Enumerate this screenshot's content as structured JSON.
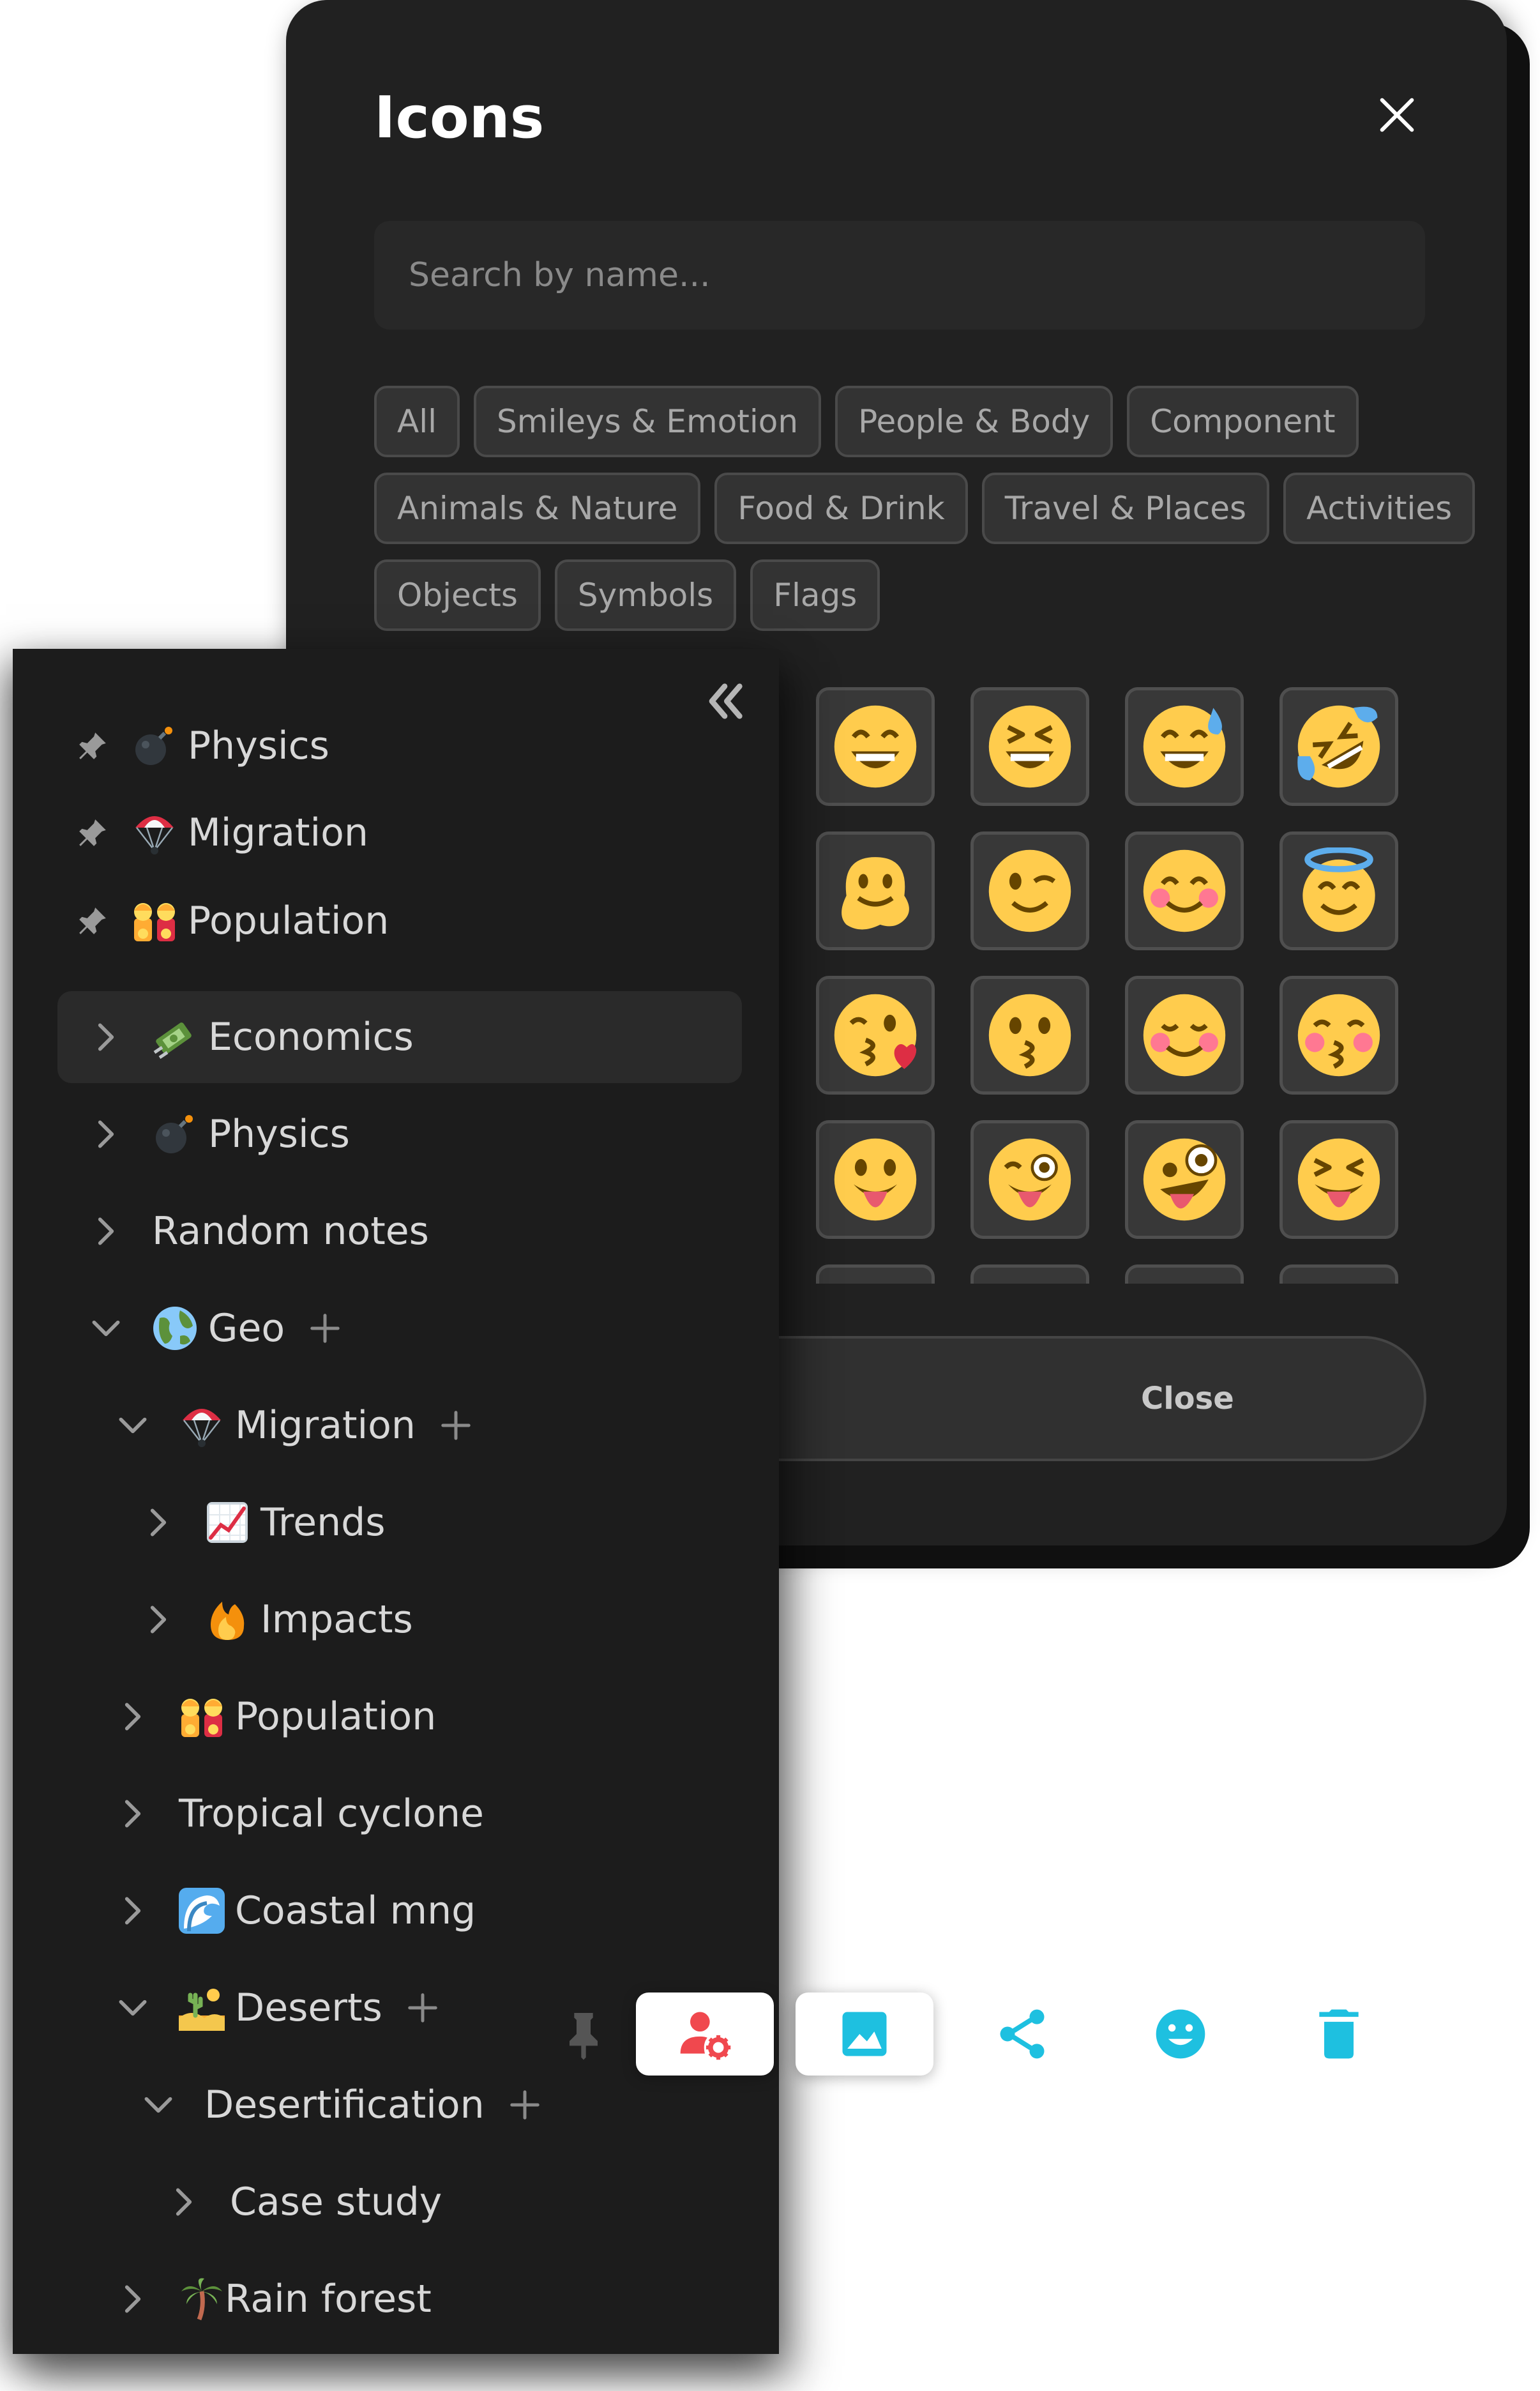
{
  "modal": {
    "title": "Icons",
    "search_placeholder": "Search by name...",
    "close_button": "Close",
    "categories": [
      [
        "All",
        "Smileys & Emotion",
        "People & Body",
        "Component"
      ],
      [
        "Animals & Nature",
        "Food & Drink",
        "Travel & Places",
        "Activities"
      ],
      [
        "Objects",
        "Symbols",
        "Flags"
      ]
    ],
    "emoji_grid_names": [
      [
        "grinning-face-with-smiling-eyes",
        "grinning-squinting-face",
        "grinning-face-with-sweat",
        "rolling-on-the-floor-laughing"
      ],
      [
        "melting-face",
        "winking-face",
        "smiling-face-with-smiling-eyes",
        "smiling-face-with-halo"
      ],
      [
        "face-blowing-a-kiss",
        "kissing-face",
        "smiling-face",
        "kissing-face-with-closed-eyes"
      ],
      [
        "face-with-tongue",
        "winking-face-with-tongue",
        "zany-face",
        "squinting-face-with-tongue"
      ]
    ]
  },
  "sidebar": {
    "pinned": [
      {
        "label": "Physics",
        "icon": "bomb-icon"
      },
      {
        "label": "Migration",
        "icon": "parachute-icon"
      },
      {
        "label": "Population",
        "icon": "family-icon"
      }
    ],
    "tree": [
      {
        "label": "Economics",
        "icon": "money-with-wings-icon",
        "expanded": false,
        "selected": true
      },
      {
        "label": "Physics",
        "icon": "bomb-icon",
        "expanded": false
      },
      {
        "label": "Random notes",
        "icon": "",
        "expanded": false
      },
      {
        "label": "Geo",
        "icon": "globe-icon",
        "expanded": true
      },
      {
        "label": "Migration",
        "icon": "parachute-icon",
        "expanded": true
      },
      {
        "label": "Trends",
        "icon": "chart-increasing-icon",
        "expanded": false
      },
      {
        "label": "Impacts",
        "icon": "fire-icon",
        "expanded": false
      },
      {
        "label": "Population",
        "icon": "family-icon",
        "expanded": false
      },
      {
        "label": "Tropical cyclone",
        "icon": "",
        "expanded": false
      },
      {
        "label": "Coastal mng",
        "icon": "water-wave-icon",
        "expanded": false
      },
      {
        "label": "Deserts",
        "icon": "desert-icon",
        "expanded": true
      },
      {
        "label": "Desertification",
        "icon": "",
        "expanded": true
      },
      {
        "label": "Case study",
        "icon": "",
        "expanded": false
      },
      {
        "label": "Rain forest",
        "icon": "palm-tree-icon",
        "expanded": false
      }
    ]
  },
  "toolbar": {
    "icons": [
      "pin-icon",
      "user-settings-icon",
      "image-icon",
      "share-icon",
      "emoji-icon",
      "delete-icon"
    ],
    "accent_color": "#1ec0e0",
    "danger_color": "#f0484e"
  },
  "colors": {
    "modal_bg": "#212121",
    "sidebar_bg": "#1c1c1c"
  }
}
